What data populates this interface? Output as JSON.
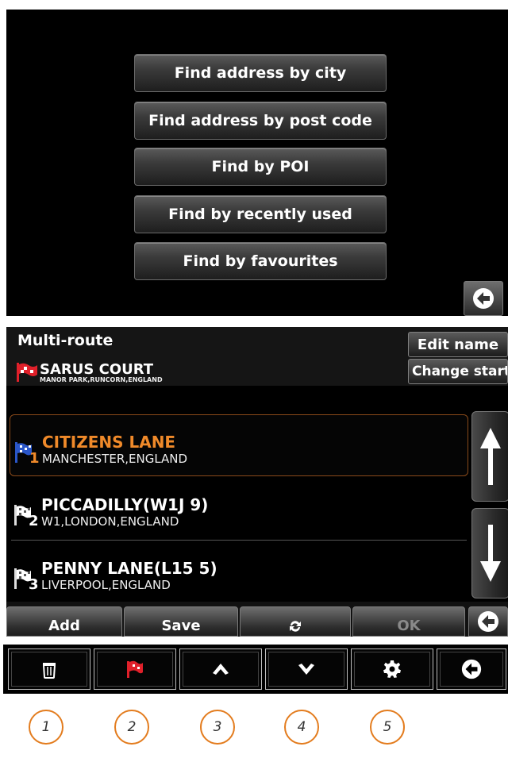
{
  "search_menu": {
    "buttons": [
      "Find address by city",
      "Find address by post code",
      "Find by POI",
      "Find by recently used",
      "Find by favourites"
    ],
    "back_icon": "back-arrow-icon"
  },
  "multi_route": {
    "title": "Multi-route",
    "edit_name_label": "Edit name",
    "change_start_label": "Change start",
    "start": {
      "name": "SARUS COURT",
      "address": "MANOR PARK,RUNCORN,ENGLAND"
    },
    "stops": [
      {
        "number": "1",
        "name": "CITIZENS LANE",
        "address": "MANCHESTER,ENGLAND",
        "selected": true
      },
      {
        "number": "2",
        "name": "PICCADILLY(W1J 9)",
        "address": "W1,LONDON,ENGLAND",
        "selected": false
      },
      {
        "number": "3",
        "name": "PENNY LANE(L15 5)",
        "address": "LIVERPOOL,ENGLAND",
        "selected": false
      }
    ],
    "buttons": {
      "add": "Add",
      "save": "Save",
      "ok": "OK"
    },
    "colors": {
      "selected_text": "#f08a2a",
      "start_flag": "#e0202a",
      "selected_flag": "#2a56c8"
    }
  },
  "toolbar": {
    "icons": [
      "trash-icon",
      "flag-icon",
      "chevron-up-icon",
      "chevron-down-icon",
      "gear-icon",
      "back-arrow-icon"
    ],
    "callouts": [
      "1",
      "2",
      "3",
      "4",
      "5"
    ]
  }
}
